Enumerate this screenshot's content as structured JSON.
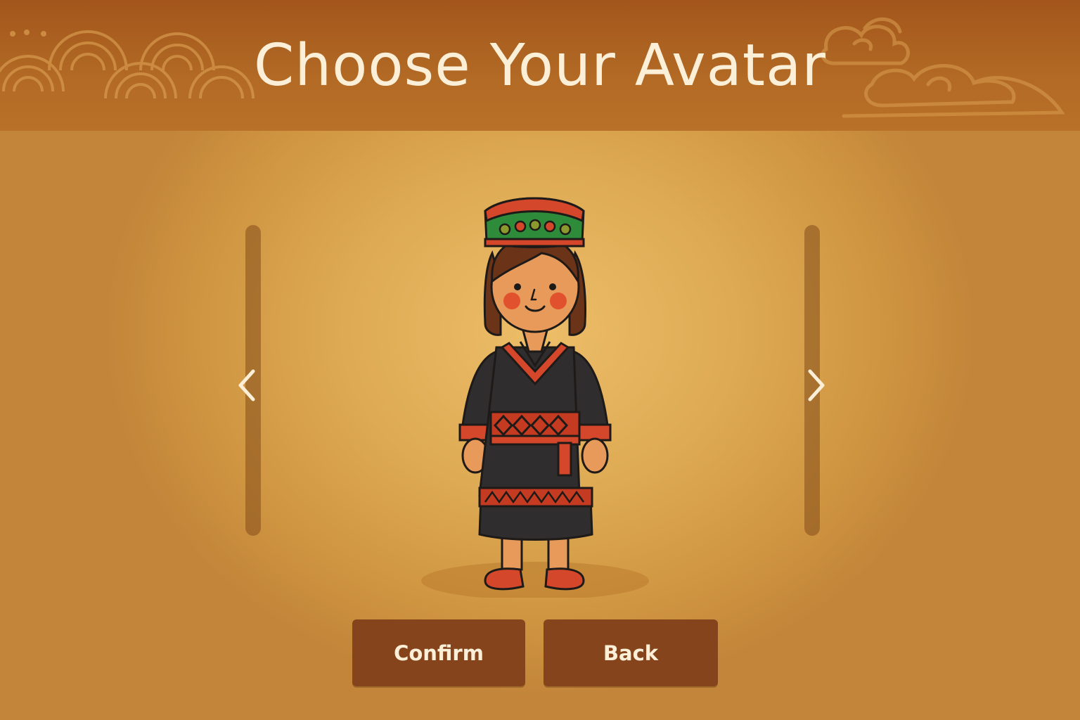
{
  "header": {
    "title": "Choose Your Avatar"
  },
  "navigation": {
    "previous_icon": "chevron-left-icon",
    "next_icon": "chevron-right-icon"
  },
  "avatar": {
    "description_icon": "girl-in-traditional-dress"
  },
  "buttons": {
    "confirm_label": "Confirm",
    "back_label": "Back"
  },
  "colors": {
    "header": "#a3561b",
    "background": "#deaa54",
    "button": "#85441b",
    "title_text": "#fbf0d7"
  }
}
